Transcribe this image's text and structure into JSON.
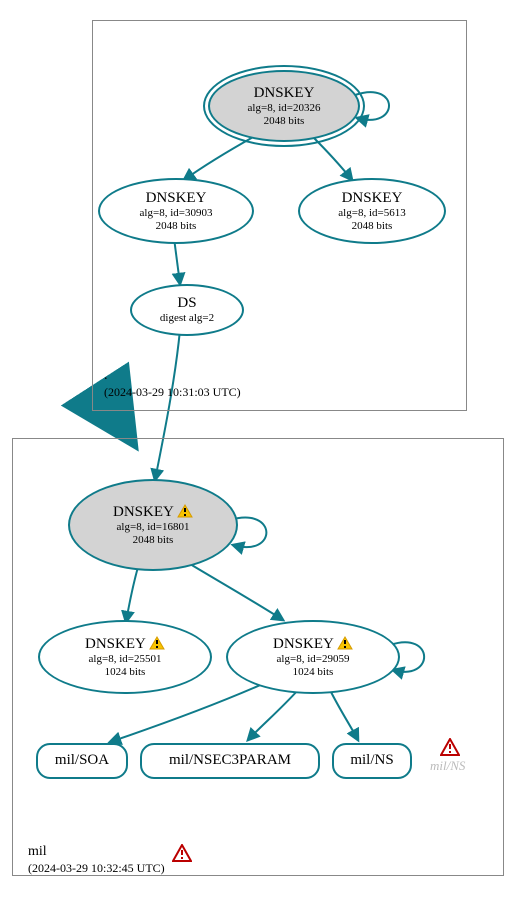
{
  "chart_data": {
    "type": "diagram",
    "description": "DNSSEC authentication / delegation graph from root zone to mil zone",
    "zones": [
      {
        "name": ".",
        "timestamp": "(2024-03-29 10:31:03 UTC)",
        "status": "ok"
      },
      {
        "name": "mil",
        "timestamp": "(2024-03-29 10:32:45 UTC)",
        "status": "error"
      }
    ],
    "nodes": [
      {
        "id": "root-ksk",
        "zone": ".",
        "type": "DNSKEY",
        "ksk": true,
        "alg": 8,
        "key_id": 20326,
        "bits": 2048,
        "status": "ok"
      },
      {
        "id": "root-zsk1",
        "zone": ".",
        "type": "DNSKEY",
        "ksk": false,
        "alg": 8,
        "key_id": 30903,
        "bits": 2048,
        "status": "ok"
      },
      {
        "id": "root-zsk2",
        "zone": ".",
        "type": "DNSKEY",
        "ksk": false,
        "alg": 8,
        "key_id": 5613,
        "bits": 2048,
        "status": "ok"
      },
      {
        "id": "root-ds",
        "zone": ".",
        "type": "DS",
        "digest_alg": 2,
        "status": "ok"
      },
      {
        "id": "mil-ksk",
        "zone": "mil",
        "type": "DNSKEY",
        "ksk": true,
        "alg": 8,
        "key_id": 16801,
        "bits": 2048,
        "status": "warn"
      },
      {
        "id": "mil-zsk1",
        "zone": "mil",
        "type": "DNSKEY",
        "ksk": false,
        "alg": 8,
        "key_id": 25501,
        "bits": 1024,
        "status": "warn"
      },
      {
        "id": "mil-zsk2",
        "zone": "mil",
        "type": "DNSKEY",
        "ksk": false,
        "alg": 8,
        "key_id": 29059,
        "bits": 1024,
        "status": "warn"
      },
      {
        "id": "mil-soa",
        "zone": "mil",
        "type": "RR",
        "label": "mil/SOA",
        "status": "ok"
      },
      {
        "id": "mil-n3p",
        "zone": "mil",
        "type": "RR",
        "label": "mil/NSEC3PARAM",
        "status": "ok"
      },
      {
        "id": "mil-ns",
        "zone": "mil",
        "type": "RR",
        "label": "mil/NS",
        "status": "ok"
      },
      {
        "id": "mil-ns-bad",
        "zone": "mil",
        "type": "RR-missing",
        "label": "mil/NS",
        "status": "error"
      }
    ],
    "edges": [
      [
        "root-ksk",
        "root-ksk"
      ],
      [
        "root-ksk",
        "root-zsk1"
      ],
      [
        "root-ksk",
        "root-zsk2"
      ],
      [
        "root-zsk1",
        "root-ds"
      ],
      [
        "root-ds",
        "mil-ksk"
      ],
      [
        "mil-ksk",
        "mil-ksk"
      ],
      [
        "mil-ksk",
        "mil-zsk1"
      ],
      [
        "mil-ksk",
        "mil-zsk2"
      ],
      [
        "mil-zsk2",
        "mil-zsk2"
      ],
      [
        "mil-zsk2",
        "mil-soa"
      ],
      [
        "mil-zsk2",
        "mil-n3p"
      ],
      [
        "mil-zsk2",
        "mil-ns"
      ]
    ]
  },
  "zones": {
    "root": {
      "name": ".",
      "time": "(2024-03-29 10:31:03 UTC)"
    },
    "mil": {
      "name": "mil",
      "time": "(2024-03-29 10:32:45 UTC)"
    }
  },
  "nodes": {
    "root_ksk": {
      "title": "DNSKEY",
      "info": "alg=8, id=20326",
      "bits": "2048 bits"
    },
    "root_zsk1": {
      "title": "DNSKEY",
      "info": "alg=8, id=30903",
      "bits": "2048 bits"
    },
    "root_zsk2": {
      "title": "DNSKEY",
      "info": "alg=8, id=5613",
      "bits": "2048 bits"
    },
    "root_ds": {
      "title": "DS",
      "info": "digest alg=2"
    },
    "mil_ksk": {
      "title": "DNSKEY",
      "info": "alg=8, id=16801",
      "bits": "2048 bits"
    },
    "mil_zsk1": {
      "title": "DNSKEY",
      "info": "alg=8, id=25501",
      "bits": "1024 bits"
    },
    "mil_zsk2": {
      "title": "DNSKEY",
      "info": "alg=8, id=29059",
      "bits": "1024 bits"
    },
    "mil_soa": {
      "label": "mil/SOA"
    },
    "mil_n3p": {
      "label": "mil/NSEC3PARAM"
    },
    "mil_ns": {
      "label": "mil/NS"
    },
    "mil_ns_bad": {
      "label": "mil/NS"
    }
  }
}
